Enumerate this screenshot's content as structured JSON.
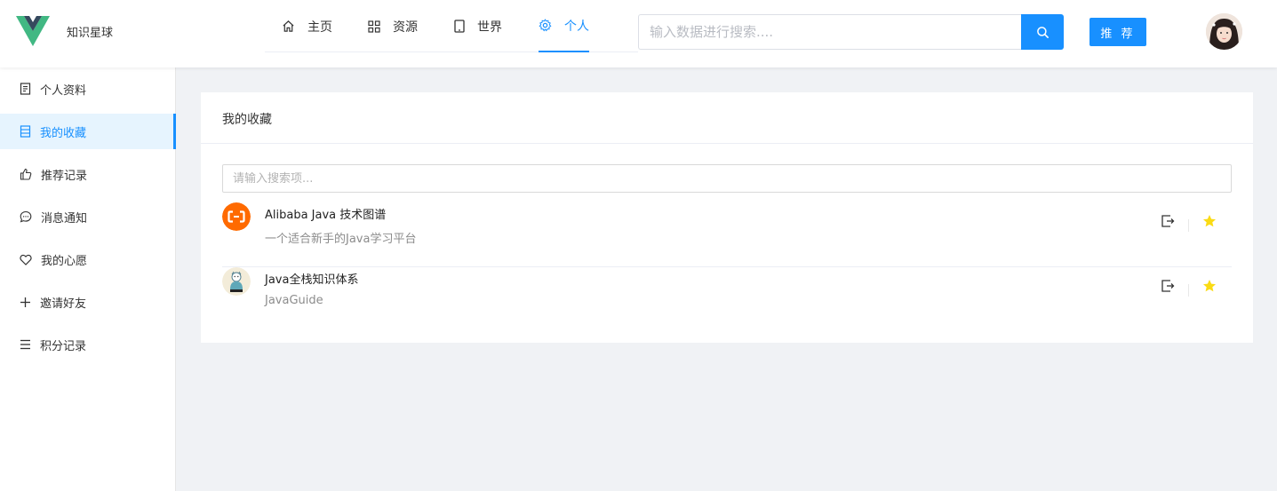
{
  "header": {
    "brand": "知识星球",
    "nav": [
      {
        "label": "主页",
        "icon": "home-icon"
      },
      {
        "label": "资源",
        "icon": "grid-icon"
      },
      {
        "label": "世界",
        "icon": "tablet-icon"
      },
      {
        "label": "个人",
        "icon": "gear-icon",
        "active": true
      }
    ],
    "search_placeholder": "输入数据进行搜索....",
    "recommend_label": "推 荐"
  },
  "sidebar": {
    "items": [
      {
        "label": "个人资料",
        "icon": "profile-doc-icon"
      },
      {
        "label": "我的收藏",
        "icon": "bookmark-book-icon",
        "active": true
      },
      {
        "label": "推荐记录",
        "icon": "thumbs-up-icon"
      },
      {
        "label": "消息通知",
        "icon": "chat-bubble-icon"
      },
      {
        "label": "我的心愿",
        "icon": "heart-icon"
      },
      {
        "label": "邀请好友",
        "icon": "plus-icon"
      },
      {
        "label": "积分记录",
        "icon": "list-icon"
      }
    ]
  },
  "main": {
    "title": "我的收藏",
    "search_placeholder": "请输入搜索项...",
    "items": [
      {
        "title": "Alibaba Java 技术图谱",
        "desc": "一个适合新手的Java学习平台"
      },
      {
        "title": "Java全栈知识体系",
        "desc": "JavaGuide"
      }
    ]
  },
  "colors": {
    "accent": "#1890ff",
    "star": "#fadb14",
    "alibaba": "#ff6a00"
  }
}
